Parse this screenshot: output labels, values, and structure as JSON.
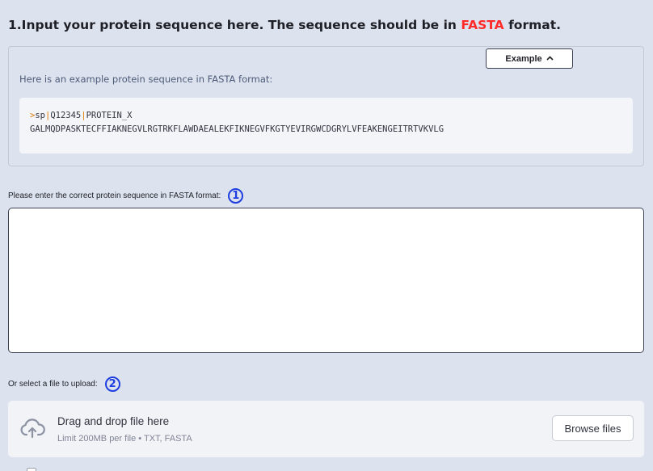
{
  "section": {
    "heading_before": "1.Input your protein sequence here. The sequence should be in ",
    "heading_accent": "FASTA",
    "heading_after": " format."
  },
  "example": {
    "button_label": "Example",
    "button_icon": "chevron-up-icon",
    "caption": "Here is an example protein sequence in FASTA format:",
    "code_gt": ">",
    "code_db": "sp",
    "code_pipe": "|",
    "code_acc": "Q12345",
    "code_name": "PROTEIN_X",
    "code_seq": "GALMQDPASKTECFFIAKNEGVLRGTRKFLAWDAEALEKFIKNEGVFKGTYEVIRGWCDGRYLVFEAKENGEITRTVKVLG"
  },
  "sequence_input": {
    "label": "Please enter the correct protein sequence in FASTA format:",
    "step": "1",
    "value": ""
  },
  "upload": {
    "label": "Or select a file to upload:",
    "step": "2",
    "icon": "cloud-upload-icon",
    "title": "Drag and drop file here",
    "limit": "Limit 200MB per file • TXT, FASTA",
    "browse_label": "Browse files"
  },
  "colors": {
    "background": "#dde3ee",
    "accent_red": "#ff2b2b",
    "step_blue": "#1f3ee0",
    "code_orange": "#e07b00"
  }
}
